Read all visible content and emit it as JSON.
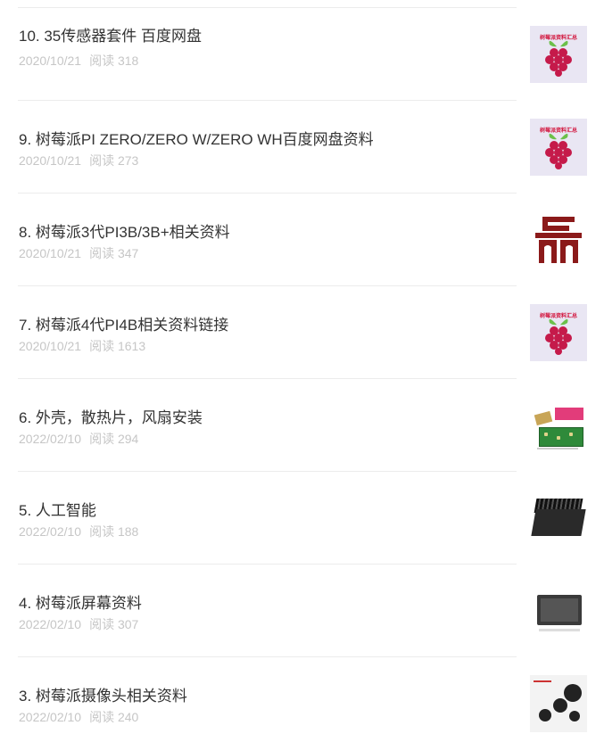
{
  "articles": [
    {
      "title": "10. 35传感器套件 百度网盘",
      "date": "2020/10/21",
      "reads": "阅读 318",
      "thumb": "raspberry-pi-logo",
      "caption": "树莓派资料汇总"
    },
    {
      "title": "9. 树莓派PI ZERO/ZERO W/ZERO WH百度网盘资料",
      "date": "2020/10/21",
      "reads": "阅读 273",
      "thumb": "raspberry-pi-logo",
      "caption": "树莓派资料汇总"
    },
    {
      "title": "8. 树莓派3代PI3B/3B+相关资料",
      "date": "2020/10/21",
      "reads": "阅读 347",
      "thumb": "brand-logo"
    },
    {
      "title": "7. 树莓派4代PI4B相关资料链接",
      "date": "2020/10/21",
      "reads": "阅读 1613",
      "thumb": "raspberry-pi-logo",
      "caption": "树莓派资料汇总"
    },
    {
      "title": "6. 外壳，散热片，风扇安装",
      "date": "2022/02/10",
      "reads": "阅读 294",
      "thumb": "case-photo"
    },
    {
      "title": "5. 人工智能",
      "date": "2022/02/10",
      "reads": "阅读 188",
      "thumb": "jetson-photo"
    },
    {
      "title": "4. 树莓派屏幕资料",
      "date": "2022/02/10",
      "reads": "阅读 307",
      "thumb": "screen-photo"
    },
    {
      "title": "3. 树莓派摄像头相关资料",
      "date": "2022/02/10",
      "reads": "阅读 240",
      "thumb": "camera-photo"
    }
  ],
  "colors": {
    "title": "#333333",
    "meta": "#c6c6c6",
    "divider": "#ececec",
    "raspberry": "#c51a4a",
    "leaf": "#6cc04a",
    "brand": "#8b1a1a"
  }
}
